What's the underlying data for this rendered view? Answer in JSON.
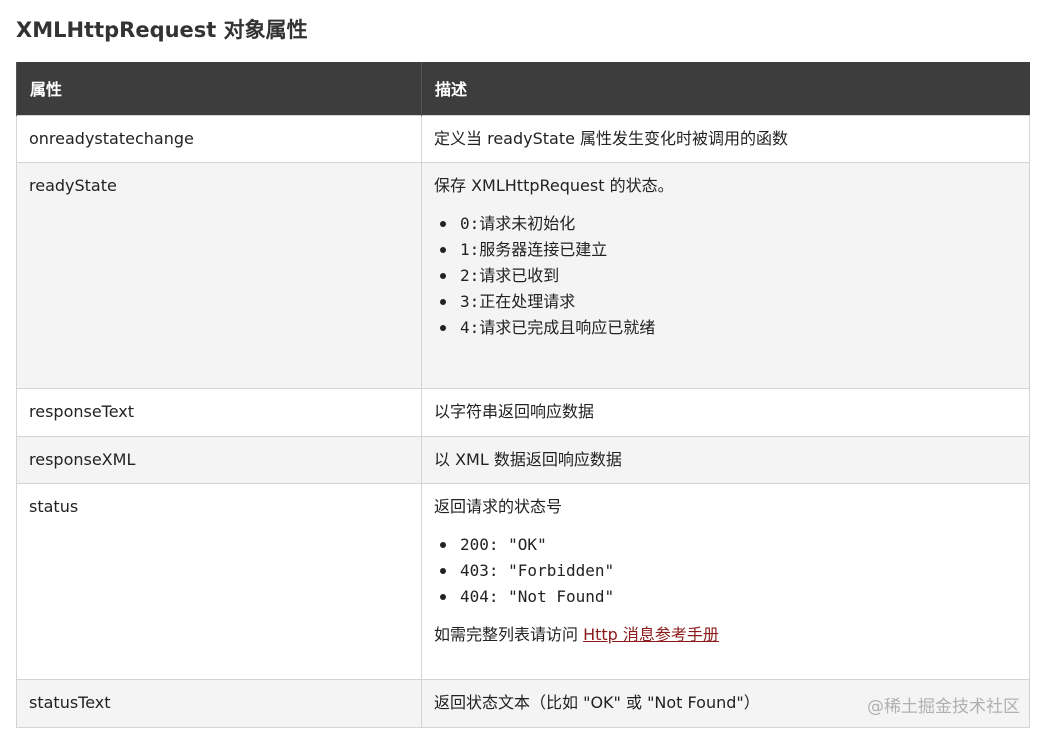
{
  "page": {
    "title": "XMLHttpRequest 对象属性"
  },
  "table": {
    "headers": {
      "property": "属性",
      "description": "描述"
    },
    "rows": [
      {
        "property": "onreadystatechange",
        "description": "定义当 readyState 属性发生变化时被调用的函数"
      },
      {
        "property": "readyState",
        "description": "保存 XMLHttpRequest 的状态。",
        "items": [
          {
            "code": "0:",
            "text": "请求未初始化"
          },
          {
            "code": "1:",
            "text": "服务器连接已建立"
          },
          {
            "code": "2:",
            "text": "请求已收到"
          },
          {
            "code": "3:",
            "text": "正在处理请求"
          },
          {
            "code": "4:",
            "text": "请求已完成且响应已就绪"
          }
        ]
      },
      {
        "property": "responseText",
        "description": "以字符串返回响应数据"
      },
      {
        "property": "responseXML",
        "description": "以 XML 数据返回响应数据"
      },
      {
        "property": "status",
        "description": "返回请求的状态号",
        "items": [
          {
            "code": "200: \"OK\""
          },
          {
            "code": "403: \"Forbidden\""
          },
          {
            "code": "404: \"Not Found\""
          }
        ],
        "note_prefix": "如需完整列表请访问 ",
        "note_link": "Http 消息参考手册"
      },
      {
        "property": "statusText",
        "description": "返回状态文本（比如 \"OK\" 或 \"Not Found\"）"
      }
    ]
  },
  "watermark": "@稀土掘金技术社区",
  "colors": {
    "header_bg": "#3d3d3d",
    "alt_row_bg": "#f4f4f4",
    "link": "#8b1a1a"
  }
}
